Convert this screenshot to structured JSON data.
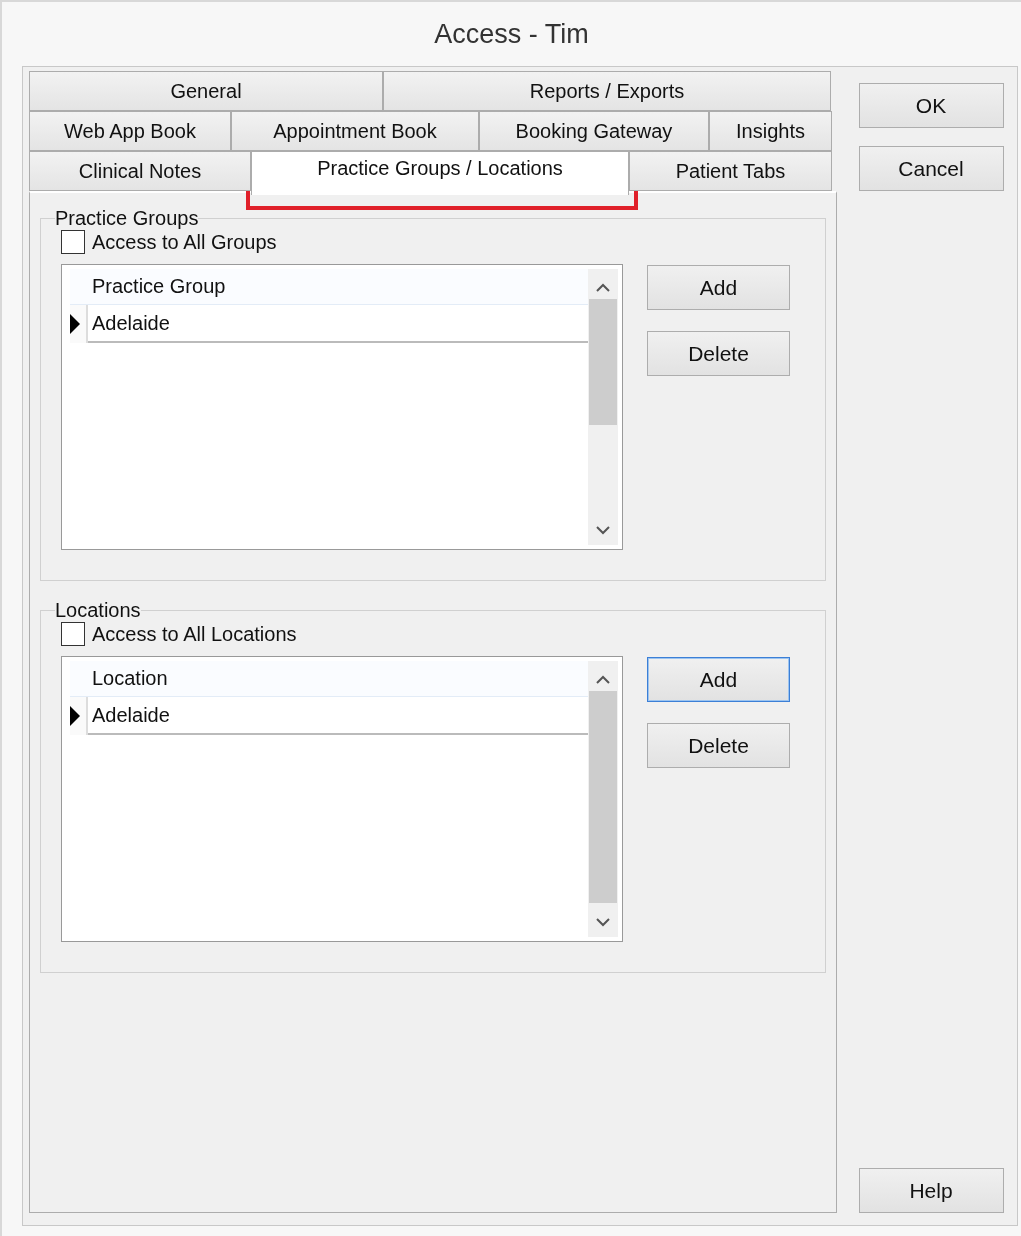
{
  "window": {
    "title": "Access - Tim"
  },
  "tab_rows": [
    {
      "tabs": [
        {
          "label": "General",
          "selected": false
        },
        {
          "label": "Reports / Exports",
          "selected": false
        }
      ]
    },
    {
      "tabs": [
        {
          "label": "Web App Book",
          "selected": false
        },
        {
          "label": "Appointment Book",
          "selected": false
        },
        {
          "label": "Booking Gateway",
          "selected": false
        },
        {
          "label": "Insights",
          "selected": false
        }
      ]
    },
    {
      "tabs": [
        {
          "label": "Clinical Notes",
          "selected": false
        },
        {
          "label": "Practice Groups / Locations",
          "selected": true
        },
        {
          "label": "Patient Tabs",
          "selected": false
        }
      ]
    }
  ],
  "sections": [
    {
      "legend": "Practice Groups",
      "checkbox": {
        "label": "Access to All Groups",
        "checked": false
      },
      "grid": {
        "column": "Practice Group",
        "rows": [
          {
            "cell": "Adelaide",
            "current": true
          }
        ]
      },
      "buttons": [
        {
          "label": "Add",
          "focused": false
        },
        {
          "label": "Delete",
          "focused": false
        }
      ]
    },
    {
      "legend": "Locations",
      "checkbox": {
        "label": "Access to All Locations",
        "checked": false
      },
      "grid": {
        "column": "Location",
        "rows": [
          {
            "cell": "Adelaide",
            "current": true
          }
        ]
      },
      "buttons": [
        {
          "label": "Add",
          "focused": true
        },
        {
          "label": "Delete",
          "focused": false
        }
      ]
    }
  ],
  "dialog_buttons": [
    {
      "label": "OK"
    },
    {
      "label": "Cancel"
    }
  ],
  "help_button": {
    "label": "Help"
  },
  "annotation": {
    "kind": "highlight-box"
  }
}
